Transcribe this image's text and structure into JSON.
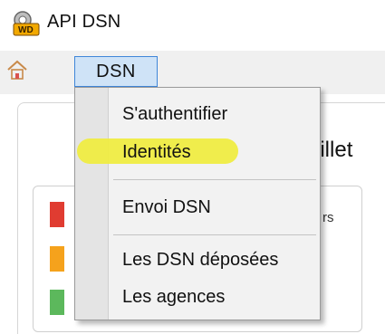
{
  "window": {
    "title": "API DSN",
    "icon": "app-logo-icon"
  },
  "menubar": {
    "home_icon": "home-icon",
    "dsn_label": "DSN"
  },
  "background": {
    "heading_fragment": "uillet",
    "text_fragment": "rs",
    "status_colors": [
      "#e03c31",
      "#f5a21c",
      "#5cb85c"
    ]
  },
  "dropdown": {
    "items": [
      {
        "label": "S'authentifier"
      },
      {
        "label": "Identités",
        "highlighted": true
      },
      {
        "label": "Envoi DSN"
      },
      {
        "label": "Les DSN déposées"
      },
      {
        "label": "Les agences"
      }
    ],
    "highlight_color": "#efec3a"
  }
}
